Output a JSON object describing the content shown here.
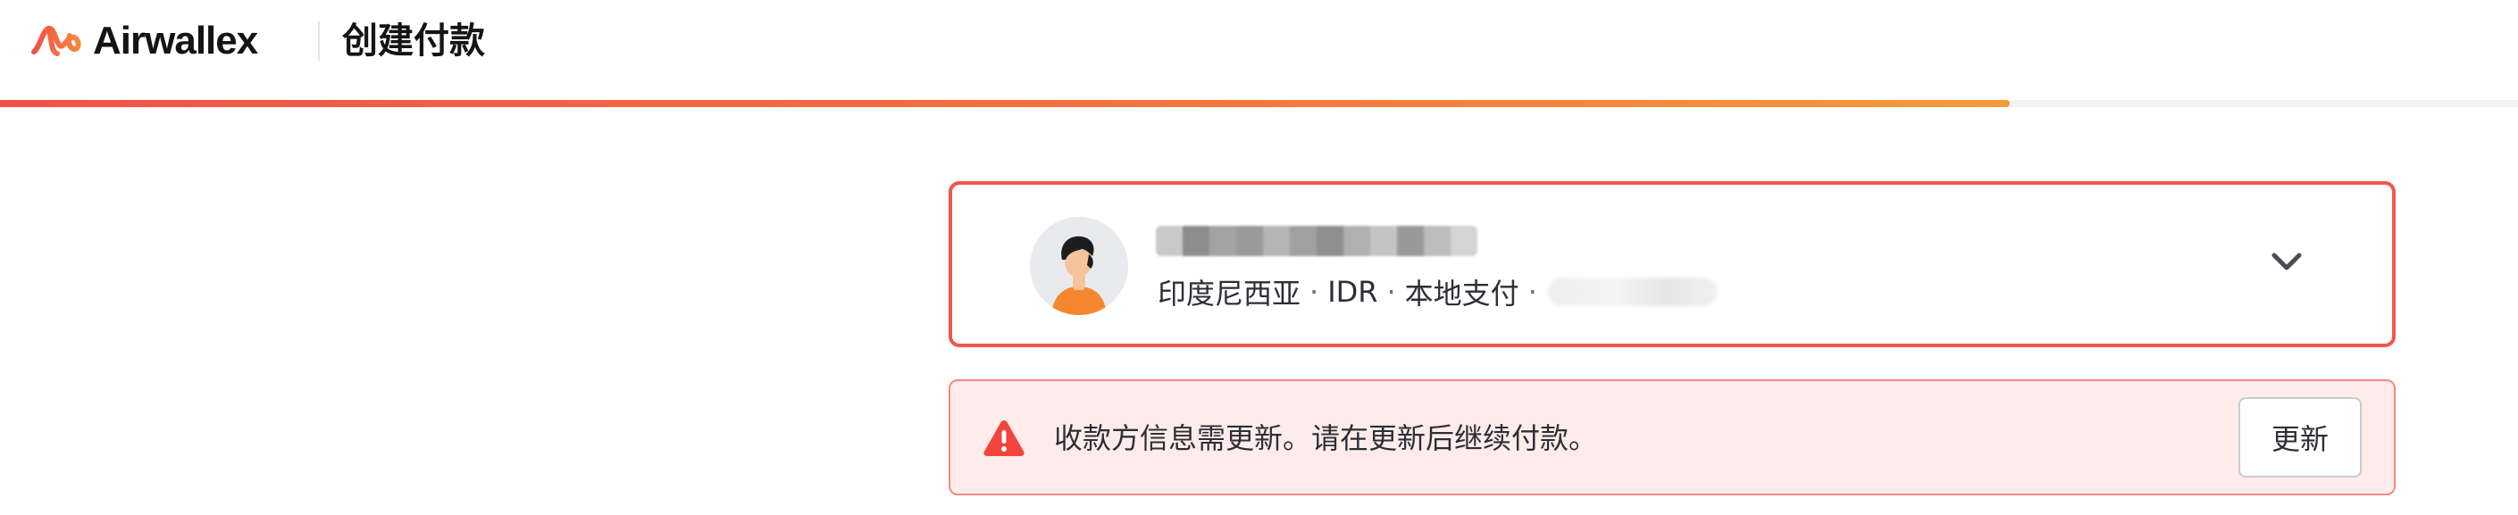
{
  "app": {
    "brand_name": "Airwallex",
    "page_title": "创建付款",
    "brand_colors": {
      "accent_red": "#f1564e",
      "accent_orange": "#f79a3a"
    }
  },
  "progress": {
    "value_fraction": 0.798
  },
  "beneficiary": {
    "avatar_icon": "person-avatar-icon",
    "name": "",
    "country": "印度尼西亚",
    "currency": "IDR",
    "payment_method": "本地支付",
    "separator": "·",
    "account": "",
    "expand_icon": "chevron-down-icon",
    "border_color": "#f1564e"
  },
  "alert": {
    "icon": "warning-icon",
    "message": "收款方信息需更新。请在更新后继续付款。",
    "button_label": "更新",
    "background_color": "#feeceb",
    "icon_color": "#f1453d"
  }
}
